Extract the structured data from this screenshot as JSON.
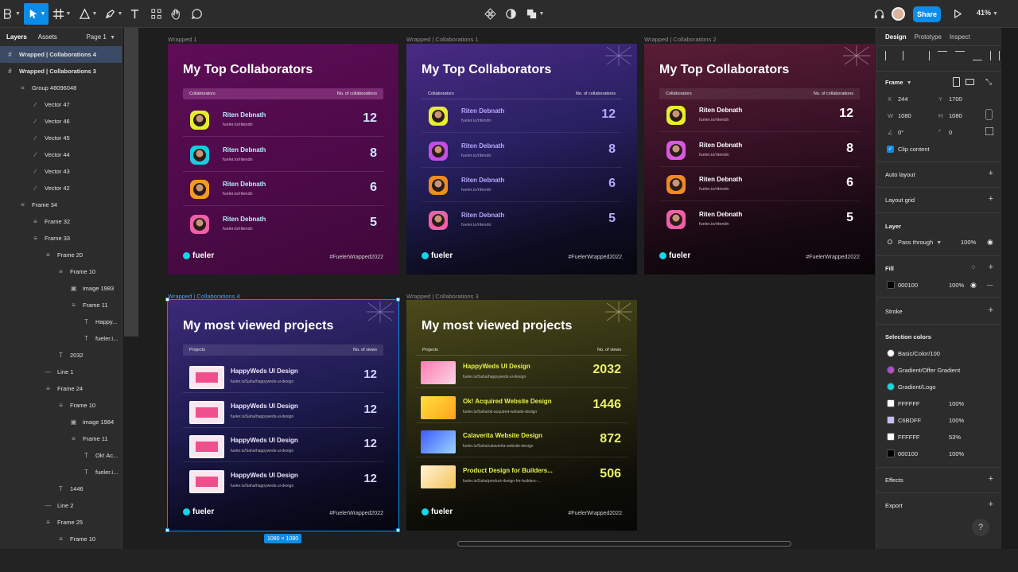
{
  "toolbar": {
    "share_label": "Share",
    "zoom": "41%"
  },
  "layers_panel": {
    "tabs": [
      "Layers",
      "Assets"
    ],
    "page": "Page 1",
    "items": [
      {
        "label": "Wrapped | Collaborations 4",
        "icon": "frame-icon"
      },
      {
        "label": "Wrapped | Collaborations 3",
        "icon": "frame-icon"
      },
      {
        "label": "Group 48096048",
        "icon": "group-icon"
      },
      {
        "label": "Vector 47",
        "icon": "vector-icon"
      },
      {
        "label": "Vector 46",
        "icon": "vector-icon"
      },
      {
        "label": "Vector 45",
        "icon": "vector-icon"
      },
      {
        "label": "Vector 44",
        "icon": "vector-icon"
      },
      {
        "label": "Vector 43",
        "icon": "vector-icon"
      },
      {
        "label": "Vector 42",
        "icon": "vector-icon"
      },
      {
        "label": "Frame 34",
        "icon": "auto-layout-icon"
      },
      {
        "label": "Frame 32",
        "icon": "auto-layout-icon"
      },
      {
        "label": "Frame 33",
        "icon": "auto-layout-icon"
      },
      {
        "label": "Frame 20",
        "icon": "auto-layout-icon"
      },
      {
        "label": "Frame 10",
        "icon": "auto-layout-icon"
      },
      {
        "label": "image 1983",
        "icon": "image-icon"
      },
      {
        "label": "Frame 11",
        "icon": "auto-layout-icon"
      },
      {
        "label": "Happy...",
        "icon": "text-icon"
      },
      {
        "label": "fueler.i...",
        "icon": "text-icon"
      },
      {
        "label": "2032",
        "icon": "text-icon"
      },
      {
        "label": "Line 1",
        "icon": "line-icon"
      },
      {
        "label": "Frame 24",
        "icon": "auto-layout-icon"
      },
      {
        "label": "Frame 10",
        "icon": "auto-layout-icon"
      },
      {
        "label": "image 1984",
        "icon": "image-icon"
      },
      {
        "label": "Frame 11",
        "icon": "auto-layout-icon"
      },
      {
        "label": "Ok! Ac...",
        "icon": "text-icon"
      },
      {
        "label": "fueler.i...",
        "icon": "text-icon"
      },
      {
        "label": "1446",
        "icon": "text-icon"
      },
      {
        "label": "Line 2",
        "icon": "line-icon"
      },
      {
        "label": "Frame 25",
        "icon": "auto-layout-icon"
      },
      {
        "label": "Frame 10",
        "icon": "auto-layout-icon"
      }
    ]
  },
  "canvas": {
    "size_badge": "1080 × 1080",
    "brand": "fueler",
    "hashtag": "#FuelerWrapped2022",
    "collab_frames": [
      {
        "label": "Wrapped 1",
        "title": "My Top Collaborators"
      },
      {
        "label": "Wrapped | Collaborations 1",
        "title": "My Top Collaborators"
      },
      {
        "label": "Wrapped | Collaborations 2",
        "title": "My Top Collaborators"
      }
    ],
    "collab_head": {
      "left": "Collaborators",
      "right": "No. of collaborations"
    },
    "collab_rows": [
      {
        "name": "Riten Debnath",
        "handle": "fueler.io/ritendn",
        "count": "12"
      },
      {
        "name": "Riten Debnath",
        "handle": "fueler.io/ritendn",
        "count": "8"
      },
      {
        "name": "Riten Debnath",
        "handle": "fueler.io/ritendn",
        "count": "6"
      },
      {
        "name": "Riten Debnath",
        "handle": "fueler.io/ritendn",
        "count": "5"
      }
    ],
    "projects_frame_a": {
      "label": "Wrapped | Collaborations 4",
      "title": "My most viewed projects",
      "head": {
        "left": "Projects",
        "right": "No. of views"
      },
      "rows": [
        {
          "name": "HappyWeds UI Design",
          "url": "fueler.io/Saha/happyweds-ui-design",
          "count": "12"
        },
        {
          "name": "HappyWeds UI Design",
          "url": "fueler.io/Saha/happyweds-ui-design",
          "count": "12"
        },
        {
          "name": "HappyWeds UI Design",
          "url": "fueler.io/Saha/happyweds-ui-design",
          "count": "12"
        },
        {
          "name": "HappyWeds UI Design",
          "url": "fueler.io/Saha/happyweds-ui-design",
          "count": "12"
        }
      ]
    },
    "projects_frame_b": {
      "label": "Wrapped | Collaborations 3",
      "title": "My most viewed projects",
      "head": {
        "left": "Projects",
        "right": "No. of views"
      },
      "rows": [
        {
          "name": "HappyWeds UI Design",
          "url": "fueler.io/Saha/happyweds-ui-design",
          "count": "2032"
        },
        {
          "name": "Ok! Acquired Website Design",
          "url": "fueler.io/Saha/ok-acquired-website-design",
          "count": "1446"
        },
        {
          "name": "Calaverita Website Design",
          "url": "fueler.io/Saha/calaverita-website-design",
          "count": "872"
        },
        {
          "name": "Product Design for Builders...",
          "url": "fueler.io/Saha/product-design-for-builders-...",
          "count": "506"
        }
      ]
    }
  },
  "design_panel": {
    "tabs": [
      "Design",
      "Prototype",
      "Inspect"
    ],
    "frame": {
      "section": "Frame",
      "x_label": "X",
      "x": "244",
      "y_label": "Y",
      "y": "1700",
      "w_label": "W",
      "w": "1080",
      "h_label": "H",
      "h": "1080",
      "rotation": "0°",
      "radius": "0",
      "clip": "Clip content"
    },
    "auto_layout": "Auto layout",
    "layout_grid": "Layout grid",
    "layer": {
      "section": "Layer",
      "blend": "Pass through",
      "opacity": "100%"
    },
    "fill": {
      "section": "Fill",
      "hex": "000100",
      "opacity": "100%"
    },
    "stroke": "Stroke",
    "selection_colors": {
      "section": "Selection colors",
      "items": [
        {
          "label": "Basic/Color/100",
          "pct": "",
          "color": "#ffffff"
        },
        {
          "label": "Gradient/Offer Gradient",
          "pct": "",
          "color": "#8c4be6"
        },
        {
          "label": "Gradient/Logo",
          "pct": "",
          "color": "#13d7e4"
        },
        {
          "label": "FFFFFF",
          "pct": "100%",
          "color": "#ffffff"
        },
        {
          "label": "C6BDFF",
          "pct": "100%",
          "color": "#c6bdff"
        },
        {
          "label": "FFFFFF",
          "pct": "53%",
          "color": "#ffffff"
        },
        {
          "label": "000100",
          "pct": "100%",
          "color": "#000100"
        }
      ]
    },
    "effects": "Effects",
    "export": "Export",
    "help": "?"
  }
}
